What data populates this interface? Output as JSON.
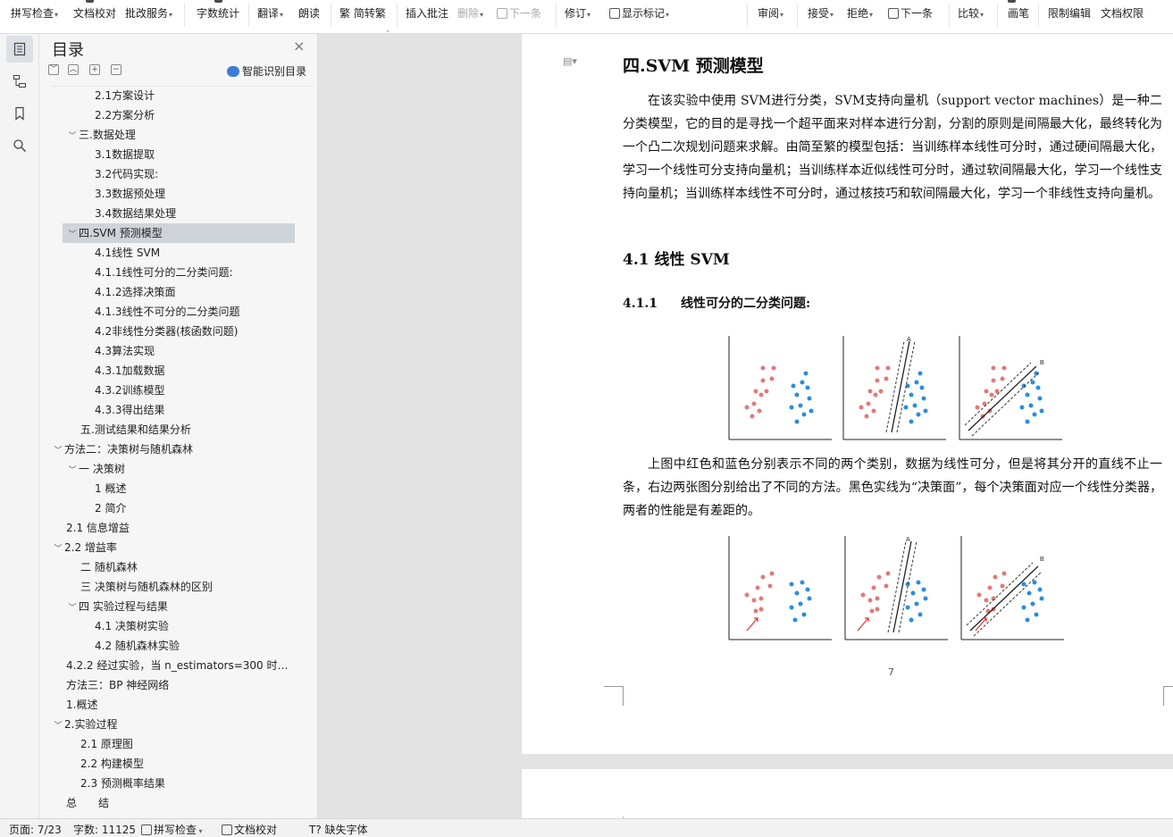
{
  "toolbar": {
    "items": [
      {
        "label": "拼写检查",
        "caret": true
      },
      {
        "label": "文档校对",
        "caret": false
      },
      {
        "label": "批改服务",
        "caret": true
      },
      {
        "label": "字数统计",
        "caret": false
      },
      {
        "label": "翻译",
        "caret": true
      },
      {
        "label": "朗读",
        "caret": false
      },
      {
        "label": "简转繁",
        "caret": false
      },
      {
        "label": "插入批注",
        "caret": false
      },
      {
        "label": "删除",
        "caret": true
      },
      {
        "label": "下一条",
        "caret": false
      },
      {
        "label": "修订",
        "caret": true
      },
      {
        "label": "显示标记",
        "caret": true
      },
      {
        "label": "审阅",
        "caret": true
      },
      {
        "label": "接受",
        "caret": true
      },
      {
        "label": "拒绝",
        "caret": true
      },
      {
        "label": "下一条",
        "caret": false
      },
      {
        "label": "比较",
        "caret": true
      },
      {
        "label": "画笔",
        "caret": false
      },
      {
        "label": "限制编辑",
        "caret": false
      },
      {
        "label": "文档权限",
        "caret": false
      }
    ]
  },
  "sidebar": {
    "title": "目录",
    "smart_toc": "智能识别目录",
    "items": [
      {
        "label": "2.1方案设计"
      },
      {
        "label": "2.2方案分析"
      },
      {
        "label": "三.数据处理"
      },
      {
        "label": "3.1数据提取"
      },
      {
        "label": "3.2代码实现:"
      },
      {
        "label": "3.3数据预处理"
      },
      {
        "label": "3.4数据结果处理"
      },
      {
        "label": "四.SVM 预测模型"
      },
      {
        "label": "4.1线性 SVM"
      },
      {
        "label": "4.1.1线性可分的二分类问题:"
      },
      {
        "label": "4.1.2选择决策面"
      },
      {
        "label": "4.1.3线性不可分的二分类问题"
      },
      {
        "label": "4.2非线性分类器(核函数问题)"
      },
      {
        "label": "4.3算法实现"
      },
      {
        "label": "4.3.1加载数据"
      },
      {
        "label": "4.3.2训练模型"
      },
      {
        "label": "4.3.3得出结果"
      },
      {
        "label": "五.测试结果和结果分析"
      },
      {
        "label": "方法二：决策树与随机森林"
      },
      {
        "label": "一 决策树"
      },
      {
        "label": "1 概述"
      },
      {
        "label": "2 简介"
      },
      {
        "label": "2.1 信息增益"
      },
      {
        "label": "2.2 增益率"
      },
      {
        "label": "二 随机森林"
      },
      {
        "label": "三 决策树与随机森林的区别"
      },
      {
        "label": "四 实验过程与结果"
      },
      {
        "label": "4.1 决策树实验"
      },
      {
        "label": "4.2 随机森林实验"
      },
      {
        "label": "4.2.2 经过实验，当 n_estimators=300 时…"
      },
      {
        "label": "方法三：BP 神经网络"
      },
      {
        "label": "1.概述"
      },
      {
        "label": "2.实验过程"
      },
      {
        "label": "2.1 原理图"
      },
      {
        "label": "2.2 构建模型"
      },
      {
        "label": "2.3 预测概率结果"
      },
      {
        "label": "总　　结"
      }
    ]
  },
  "document": {
    "heading": "四.SVM 预测模型",
    "para1": "在该实验中使用 SVM进行分类，SVM支持向量机（support vector machines）是一种二分类模型，它的目的是寻找一个超平面来对样本进行分割，分割的原则是间隔最大化，最终转化为一个凸二次规划问题来求解。由简至繁的模型包括：当训练样本线性可分时，通过硬间隔最大化，学习一个线性可分支持向量机；当训练样本近似线性可分时，通过软间隔最大化，学习一个线性支持向量机；当训练样本线性不可分时，通过核技巧和软间隔最大化，学习一个非线性支持向量机。",
    "h2": "4.1 线性 SVM",
    "h3_num": "4.1.1",
    "h3_text": "线性可分的二分类问题:",
    "para2": "上图中红色和蓝色分别表示不同的两个类别，数据为线性可分，但是将其分开的直线不止一条，右边两张图分别给出了不同的方法。黑色实线为“决策面”，每个决策面对应一个线性分类器，两者的性能是有差距的。",
    "page_number": "7",
    "fig_label_a": "A",
    "fig_label_b": "B"
  },
  "status": {
    "page": "页面: 7/23",
    "words": "字数: 11125",
    "spell": "拼写检查",
    "proof": "文档校对",
    "font": "缺失字体"
  },
  "colors": {
    "red_class": "#e37979",
    "blue_class": "#2a8de0",
    "selected": "#cfd4da"
  }
}
